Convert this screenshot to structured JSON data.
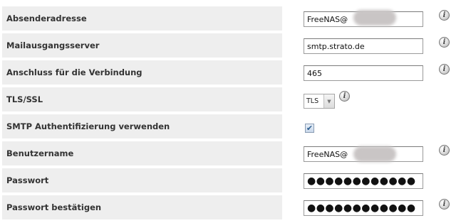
{
  "rows": [
    {
      "label": "Absenderadresse",
      "type": "text",
      "value": "FreeNAS@",
      "redacted": true,
      "info": "i"
    },
    {
      "label": "Mailausgangsserver",
      "type": "text",
      "value": "smtp.strato.de",
      "info": "i"
    },
    {
      "label": "Anschluss für die Verbindung",
      "type": "text",
      "value": "465",
      "info": "i"
    },
    {
      "label": "TLS/SSL",
      "type": "select",
      "value": "TLS",
      "info": "i"
    },
    {
      "label": "SMTP Authentifizierung verwenden",
      "type": "checkbox",
      "checked": true,
      "check_glyph": "✔"
    },
    {
      "label": "Benutzername",
      "type": "text",
      "value": "FreeNAS@",
      "redacted": true,
      "info": "i"
    },
    {
      "label": "Passwort",
      "type": "password",
      "value": "●●●●●●●●●●●●"
    },
    {
      "label": "Passwort bestätigen",
      "type": "password",
      "value": "●●●●●●●●●●●●",
      "info": "i"
    }
  ],
  "icons": {
    "info": "info-icon",
    "dropdown": "chevron-down-icon",
    "check": "checkmark-icon"
  },
  "dropdown_glyph": "▼",
  "colors": {
    "label_bg": "#eeeeee",
    "field_border": "#9a9a9a",
    "label_text": "#333333"
  }
}
